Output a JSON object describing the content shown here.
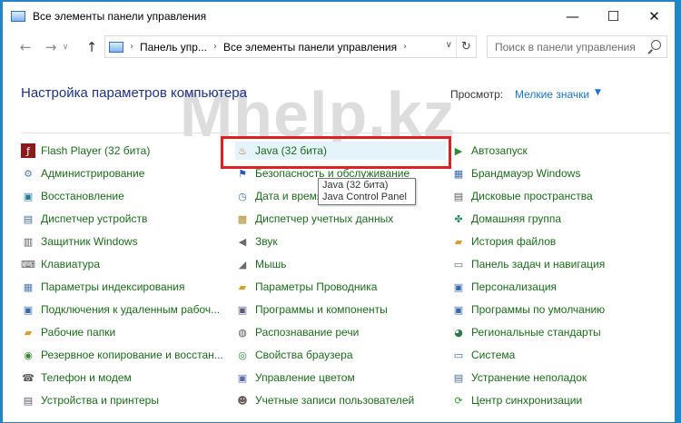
{
  "window": {
    "title": "Все элементы панели управления",
    "controls": {
      "minimize": "—",
      "maximize": "☐",
      "close": "✕"
    }
  },
  "nav": {
    "back": "←",
    "forward": "→",
    "dropdown": "∨",
    "up": "↑"
  },
  "address": {
    "crumbs": [
      "Панель упр...",
      "Все элементы панели управления"
    ],
    "refresh": "↻"
  },
  "search": {
    "placeholder": "Поиск в панели управления"
  },
  "header": {
    "title": "Настройка параметров компьютера",
    "watermark": "Mhelp.kz",
    "view_label": "Просмотр:",
    "view_value": "Мелкие значки",
    "view_arrow": "▼"
  },
  "items": {
    "col1": [
      {
        "label": "Flash Player (32 бита)",
        "icon": "flash-icon",
        "color": "#8b1a1a"
      },
      {
        "label": "Администрирование",
        "icon": "admin-tools-icon",
        "color": "#5a7fa8"
      },
      {
        "label": "Восстановление",
        "icon": "recovery-icon",
        "color": "#2a7a9a"
      },
      {
        "label": "Диспетчер устройств",
        "icon": "device-manager-icon",
        "color": "#4a6a8a"
      },
      {
        "label": "Защитник Windows",
        "icon": "defender-icon",
        "color": "#5a5a5a"
      },
      {
        "label": "Клавиатура",
        "icon": "keyboard-icon",
        "color": "#5a5a5a"
      },
      {
        "label": "Параметры индексирования",
        "icon": "indexing-icon",
        "color": "#4a7aa8"
      },
      {
        "label": "Подключения к удаленным рабоч...",
        "icon": "remote-desktop-icon",
        "color": "#3a6aa8"
      },
      {
        "label": "Рабочие папки",
        "icon": "work-folders-icon",
        "color": "#d8a030"
      },
      {
        "label": "Резервное копирование и восстан...",
        "icon": "backup-icon",
        "color": "#3a8a3a"
      },
      {
        "label": "Телефон и модем",
        "icon": "phone-modem-icon",
        "color": "#5a5a5a"
      },
      {
        "label": "Устройства и принтеры",
        "icon": "devices-printers-icon",
        "color": "#5a5a6a"
      }
    ],
    "col2": [
      {
        "label": "Java (32 бита)",
        "icon": "java-icon",
        "color": "#c05020"
      },
      {
        "label": "Безопасность и обслуживание",
        "icon": "security-maintenance-icon",
        "color": "#2a5aa8"
      },
      {
        "label": "Дата и время",
        "icon": "date-time-icon",
        "color": "#3a6aa8"
      },
      {
        "label": "Диспетчер учетных данных",
        "icon": "credential-manager-icon",
        "color": "#b08a30"
      },
      {
        "label": "Звук",
        "icon": "sound-icon",
        "color": "#6a6a6a"
      },
      {
        "label": "Мышь",
        "icon": "mouse-icon",
        "color": "#6a6a6a"
      },
      {
        "label": "Параметры Проводника",
        "icon": "explorer-options-icon",
        "color": "#d8a030"
      },
      {
        "label": "Программы и компоненты",
        "icon": "programs-features-icon",
        "color": "#5a5a7a"
      },
      {
        "label": "Распознавание речи",
        "icon": "speech-recognition-icon",
        "color": "#5a5a5a"
      },
      {
        "label": "Свойства браузера",
        "icon": "browser-properties-icon",
        "color": "#2a8a3a"
      },
      {
        "label": "Управление цветом",
        "icon": "color-management-icon",
        "color": "#5a6aa8"
      },
      {
        "label": "Учетные записи пользователей",
        "icon": "user-accounts-icon",
        "color": "#6a5a5a"
      }
    ],
    "col3": [
      {
        "label": "Автозапуск",
        "icon": "autoplay-icon",
        "color": "#2a8a3a"
      },
      {
        "label": "Брандмауэр Windows",
        "icon": "firewall-icon",
        "color": "#3a6aa8"
      },
      {
        "label": "Дисковые пространства",
        "icon": "storage-spaces-icon",
        "color": "#5a5a5a"
      },
      {
        "label": "Домашняя группа",
        "icon": "homegroup-icon",
        "color": "#2a8a6a"
      },
      {
        "label": "История файлов",
        "icon": "file-history-icon",
        "color": "#d8a030"
      },
      {
        "label": "Панель задач и навигация",
        "icon": "taskbar-icon",
        "color": "#4a6a8a"
      },
      {
        "label": "Персонализация",
        "icon": "personalization-icon",
        "color": "#3a6aa8"
      },
      {
        "label": "Программы по умолчанию",
        "icon": "default-programs-icon",
        "color": "#3a6aa8"
      },
      {
        "label": "Региональные стандарты",
        "icon": "region-icon",
        "color": "#2a7a4a"
      },
      {
        "label": "Система",
        "icon": "system-icon",
        "color": "#3a6aa8"
      },
      {
        "label": "Устранение неполадок",
        "icon": "troubleshooting-icon",
        "color": "#4a6a8a"
      },
      {
        "label": "Центр синхронизации",
        "icon": "sync-center-icon",
        "color": "#2a9a3a"
      }
    ]
  },
  "tooltip": {
    "line1": "Java (32 бита)",
    "line2": "Java Control Panel"
  }
}
